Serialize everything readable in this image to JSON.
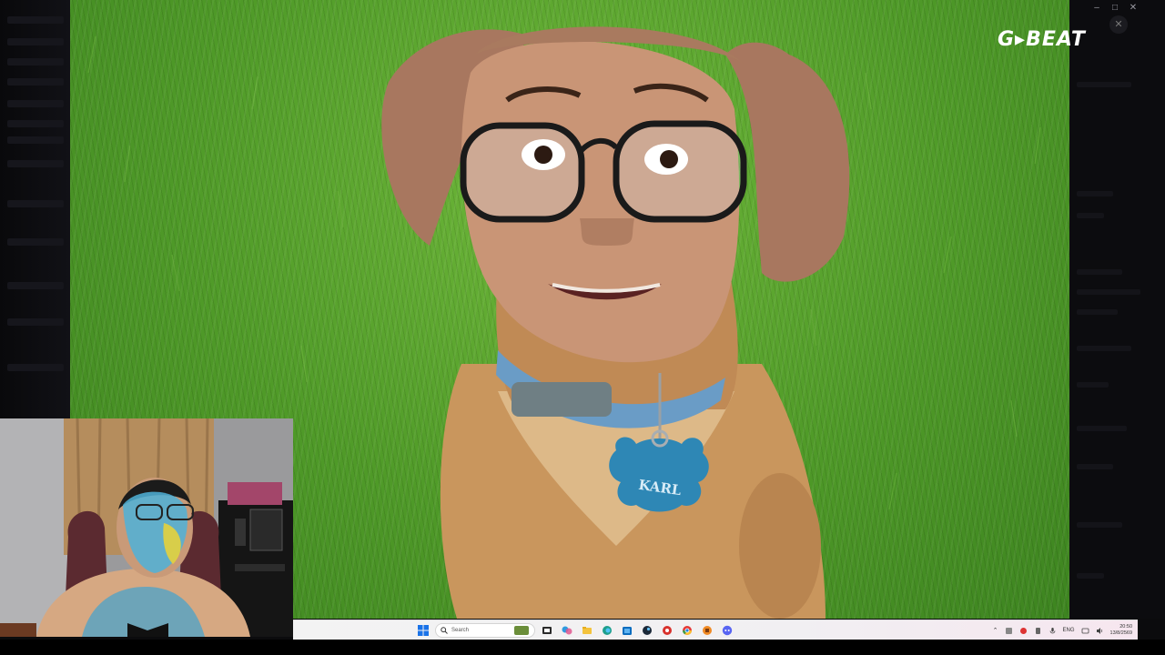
{
  "window": {
    "controls": [
      "–",
      "□",
      "✕"
    ],
    "viewer_close": "✕"
  },
  "brand": {
    "logo_text": "G▸BEAT"
  },
  "main_image": {
    "collar_tag_text": "KARL"
  },
  "taskbar": {
    "search_placeholder": "Search",
    "pinned_apps": [
      "file-explorer-icon",
      "task-view-icon",
      "copilot-icon",
      "files-icon",
      "edge-icon",
      "store-icon",
      "steam-icon",
      "app-red-icon",
      "chrome-icon",
      "app-orange-icon",
      "discord-icon"
    ],
    "tray": {
      "language": "ENG",
      "time": "20:50",
      "date": "13/8/2569"
    }
  },
  "colors": {
    "grass": "#4f9a28",
    "taskbar": "#f3f3f3",
    "tag_blue": "#2e87b5"
  }
}
